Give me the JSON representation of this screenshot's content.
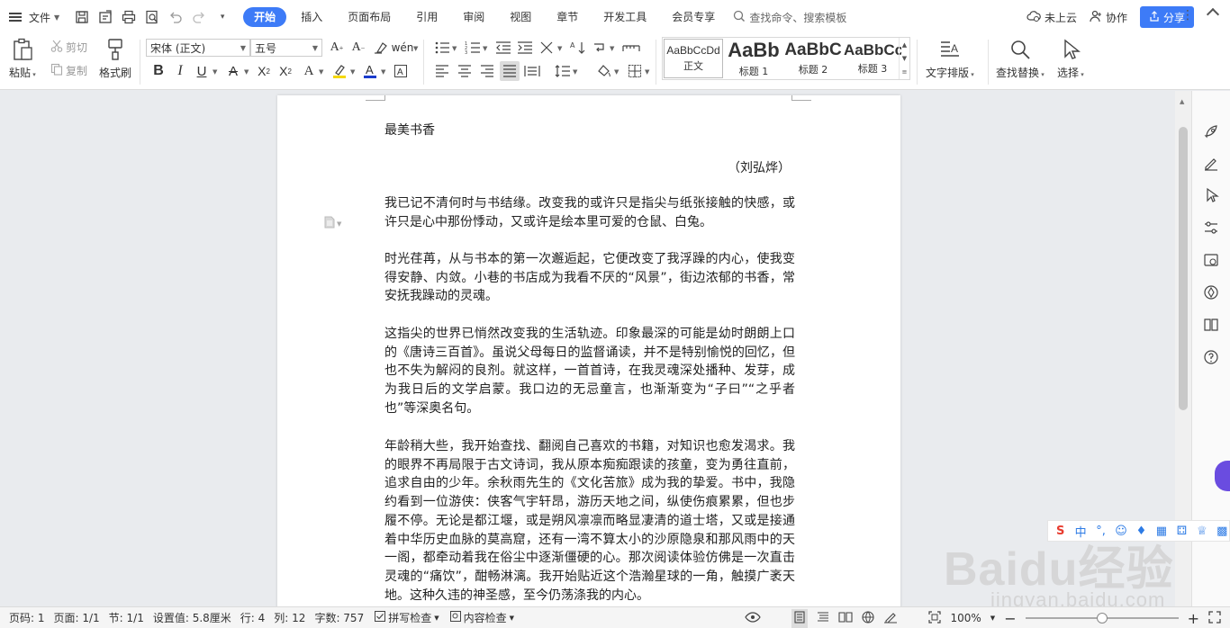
{
  "titlebar": {
    "file_label": "文件",
    "tabs": [
      "开始",
      "插入",
      "页面布局",
      "引用",
      "审阅",
      "视图",
      "章节",
      "开发工具",
      "会员专享"
    ],
    "active_tab": "开始",
    "search_placeholder": "查找命令、搜索模板",
    "cloud_label": "未上云",
    "collab_label": "协作",
    "share_label": "分享"
  },
  "ribbon": {
    "paste_label": "粘贴",
    "cut_label": "剪切",
    "copy_label": "复制",
    "format_painter_label": "格式刷",
    "font_name": "宋体 (正文)",
    "font_size": "五号",
    "styles": [
      {
        "preview": "AaBbCcDd",
        "name": "正文"
      },
      {
        "preview": "AaBb",
        "name": "标题 1"
      },
      {
        "preview": "AaBbC",
        "name": "标题 2"
      },
      {
        "preview": "AaBbCc",
        "name": "标题 3"
      }
    ],
    "text_layout_label": "文字排版",
    "find_replace_label": "查找替换",
    "select_label": "选择",
    "highlight_color": "#f5d800",
    "font_color": "#1a3ccc"
  },
  "document": {
    "title": "最美书香",
    "author": "（刘弘烨）",
    "paragraphs": [
      "我已记不清何时与书结缘。改变我的或许只是指尖与纸张接触的快感，或许只是心中那份悸动，又或许是绘本里可爱的仓鼠、白兔。",
      "时光荏苒，从与书本的第一次邂逅起，它便改变了我浮躁的内心，使我变得安静、内敛。小巷的书店成为我看不厌的“风景”，街边浓郁的书香，常安抚我躁动的灵魂。",
      "这指尖的世界已悄然改变我的生活轨迹。印象最深的可能是幼时朗朗上口的《唐诗三百首》。虽说父母每日的监督诵读，并不是特别愉悦的回忆，但也不失为解闷的良剂。就这样，一首首诗，在我灵魂深处播种、发芽，成为我日后的文学启蒙。我口边的无忌童言，也渐渐变为“子曰”“之乎者也”等深奥名句。",
      "年龄稍大些，我开始查找、翻阅自己喜欢的书籍，对知识也愈发渴求。我的眼界不再局限于古文诗词，我从原本痴痴跟读的孩童，变为勇往直前，追求自由的少年。余秋雨先生的《文化苦旅》成为我的挚爱。书中，我隐约看到一位游侠：侠客气宇轩昂，游历天地之间，纵使伤痕累累，但也步履不停。无论是都江堰，或是朔风凛凛而略显凄清的道士塔，又或是接通着中华历史血脉的莫高窟，还有一湾不算太小的沙原隐泉和那风雨中的天一阁，都牵动着我在俗尘中逐渐僵硬的心。那次阅读体验仿佛是一次直击灵魂的“痛饮”，酣畅淋漓。我开始贴近这个浩瀚星球的一角，触摸广袤天地。这种久违的神圣感，至今仍荡涤我的内心。"
    ]
  },
  "statusbar": {
    "page_num": "页码: 1",
    "page_of": "页面: 1/1",
    "section": "节: 1/1",
    "setting": "设置值: 5.8厘米",
    "row": "行: 4",
    "col": "列: 12",
    "word_count": "字数: 757",
    "spell_check": "拼写检查",
    "content_check": "内容检查",
    "zoom": "100%",
    "zoom_level": 0.5
  },
  "watermark": {
    "main": "Baidu经验",
    "sub": "jingyan.baidu.com"
  }
}
